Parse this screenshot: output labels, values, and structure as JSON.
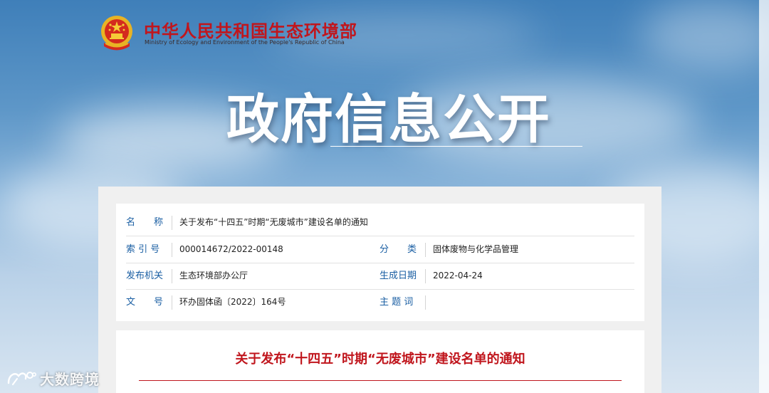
{
  "header": {
    "name_cn": "中华人民共和国生态环境部",
    "name_en": "Ministry of Ecology and Environment of the People's Republic of China",
    "emblem_icon": "national-emblem-icon"
  },
  "hero": {
    "title": "政府信息公开"
  },
  "meta": {
    "name_label": "名　　称",
    "name_value": "关于发布“十四五”时期“无废城市”建设名单的通知",
    "index_label": "索 引 号",
    "index_value": "000014672/2022-00148",
    "category_label": "分　　类",
    "category_value": "固体废物与化学品管理",
    "publisher_label": "发布机关",
    "publisher_value": "生态环境部办公厅",
    "date_label": "生成日期",
    "date_value": "2022-04-24",
    "docno_label": "文　　号",
    "docno_value": "环办固体函〔2022〕164号",
    "subject_label": "主 题 词",
    "subject_value": ""
  },
  "article": {
    "title": "关于发布“十四五”时期“无废城市”建设名单的通知"
  },
  "watermark": {
    "text": "大数跨境",
    "icon": "brand-logo-icon"
  },
  "colors": {
    "brand_red": "#c0161d",
    "label_blue": "#1b5fa3"
  }
}
